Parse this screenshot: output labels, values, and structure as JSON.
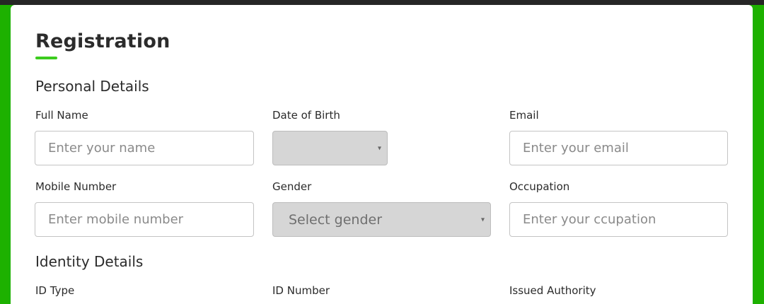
{
  "form": {
    "title": "Registration",
    "personal": {
      "heading": "Personal Details",
      "full_name": {
        "label": "Full Name",
        "placeholder": "Enter your name"
      },
      "dob": {
        "label": "Date of Birth",
        "value": ""
      },
      "email": {
        "label": "Email",
        "placeholder": "Enter your email"
      },
      "mobile": {
        "label": "Mobile Number",
        "placeholder": "Enter mobile number"
      },
      "gender": {
        "label": "Gender",
        "value": "Select gender"
      },
      "occupation": {
        "label": "Occupation",
        "placeholder": "Enter your ccupation"
      }
    },
    "identity": {
      "heading": "Identity Details",
      "id_type": {
        "label": "ID Type"
      },
      "id_number": {
        "label": "ID Number"
      },
      "issued_authority": {
        "label": "Issued Authority"
      }
    }
  },
  "icons": {
    "dropdown": "▾"
  },
  "colors": {
    "background": "#1db100",
    "accent": "#3ccc1e",
    "topbar": "#262626"
  }
}
